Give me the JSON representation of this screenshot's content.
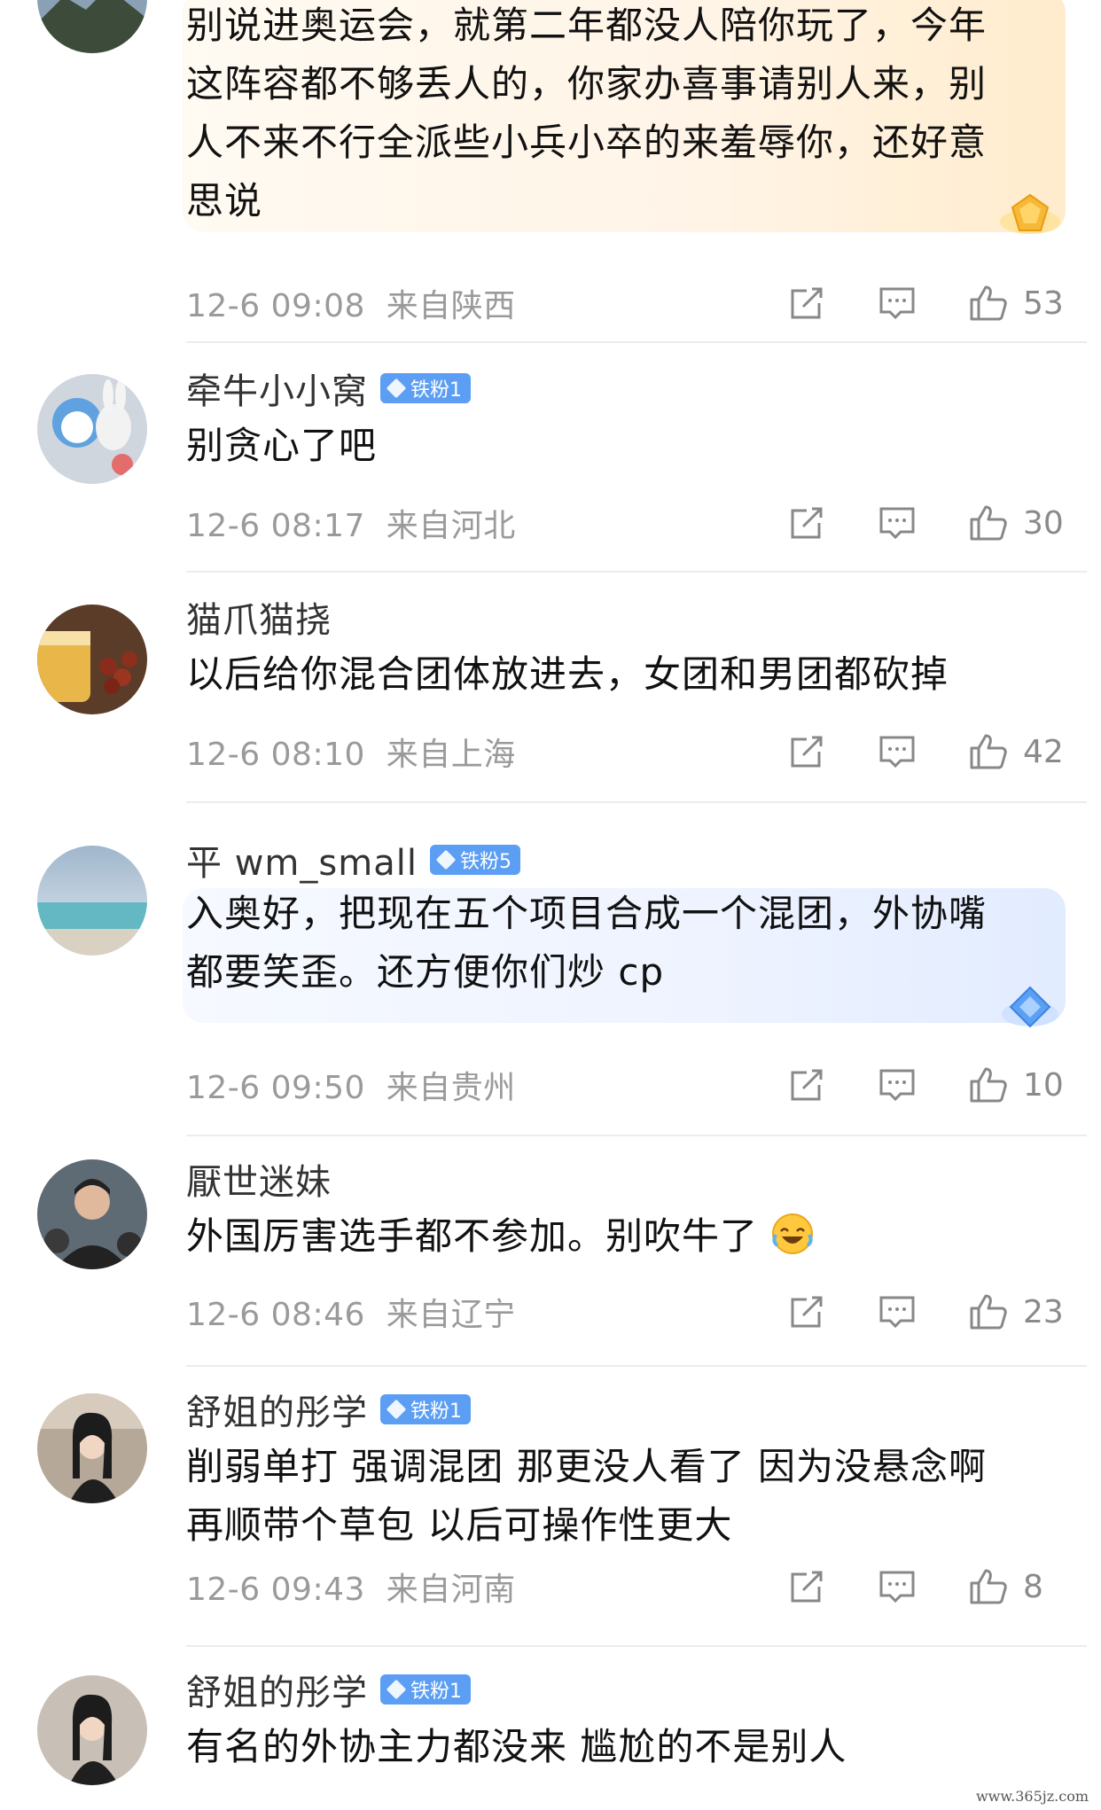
{
  "comments": [
    {
      "name": "",
      "badge": "",
      "text_lines": [
        "别说进奥运会，就第二年都没人陪你玩了，今年",
        "这阵容都不够丢人的，你家办喜事请别人来，别",
        "人不来不行全派些小兵小卒的来羞辱你，还好意",
        "思说"
      ],
      "time": "12-6 09:08",
      "location": "来自陕西",
      "likes": "53"
    },
    {
      "name": "牵牛小小窝",
      "badge": "铁粉1",
      "text_lines": [
        "别贪心了吧"
      ],
      "time": "12-6 08:17",
      "location": "来自河北",
      "likes": "30"
    },
    {
      "name": "猫爪猫挠",
      "badge": "",
      "text_lines": [
        "以后给你混合团体放进去，女团和男团都砍掉"
      ],
      "time": "12-6 08:10",
      "location": "来自上海",
      "likes": "42"
    },
    {
      "name": "平 wm_small",
      "badge": "铁粉5",
      "text_lines": [
        "入奥好，把现在五个项目合成一个混团，外协嘴",
        "都要笑歪。还方便你们炒 cp"
      ],
      "time": "12-6 09:50",
      "location": "来自贵州",
      "likes": "10"
    },
    {
      "name": "厭世迷妹",
      "badge": "",
      "text_lines": [
        "外国厉害选手都不参加。别吹牛了"
      ],
      "time": "12-6 08:46",
      "location": "来自辽宁",
      "likes": "23"
    },
    {
      "name": "舒姐的彤学",
      "badge": "铁粉1",
      "text_lines": [
        "削弱单打 强调混团 那更没人看了 因为没悬念啊",
        "再顺带个草包  以后可操作性更大"
      ],
      "time": "12-6 09:43",
      "location": "来自河南",
      "likes": "8"
    },
    {
      "name": "舒姐的彤学",
      "badge": "铁粉1",
      "text_lines": [
        "有名的外协主力都没来 尴尬的不是别人"
      ],
      "time": "",
      "location": "",
      "likes": ""
    }
  ],
  "icons": {
    "share": "share-icon",
    "reply": "reply-icon",
    "like": "like-icon",
    "emoji": "laughing-crying-emoji-icon"
  },
  "colors": {
    "badge": "#5b9ef3",
    "meta_text": "#9a9a9a",
    "divider": "#ececec"
  },
  "watermark": "www.365jz.com"
}
